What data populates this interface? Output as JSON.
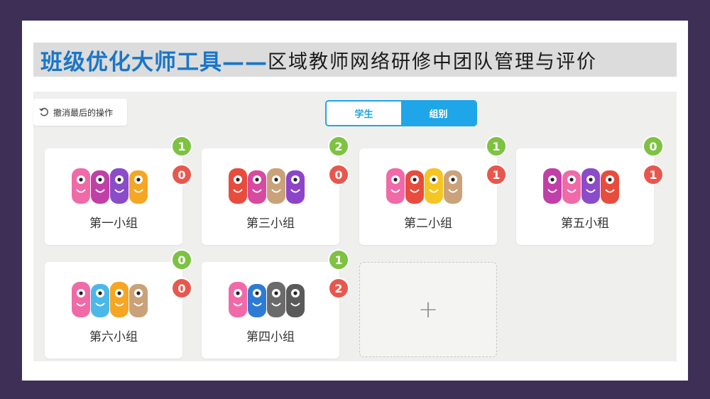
{
  "title": {
    "main": "班级优化大师工具——",
    "sub": "区域教师网络研修中团队管理与评价"
  },
  "toolbar": {
    "undo_label": "撤消最后的操作"
  },
  "view_toggle": {
    "students_label": "学生",
    "groups_label": "组别",
    "selected": "组别"
  },
  "groups": [
    {
      "name": "第一小组",
      "positive": "1",
      "negative": "0",
      "monsters": [
        "#f06aa8",
        "#c040a8",
        "#8a4cc8",
        "#f5a623"
      ]
    },
    {
      "name": "第三小组",
      "positive": "2",
      "negative": "0",
      "monsters": [
        "#e84c3d",
        "#d64aa0",
        "#c9a27a",
        "#8e44c8"
      ]
    },
    {
      "name": "第二小组",
      "positive": "1",
      "negative": "1",
      "monsters": [
        "#f06aa8",
        "#e84c3d",
        "#f5c623",
        "#caa37a"
      ]
    },
    {
      "name": "第五小租",
      "positive": "0",
      "negative": "1",
      "monsters": [
        "#c040a8",
        "#f06aa8",
        "#8a4cc8",
        "#e84c3d"
      ]
    },
    {
      "name": "第六小组",
      "positive": "0",
      "negative": "0",
      "monsters": [
        "#f06aa8",
        "#4ab8e8",
        "#f5a623",
        "#c9a27a"
      ]
    },
    {
      "name": "第四小组",
      "positive": "1",
      "negative": "2",
      "monsters": [
        "#f06aa8",
        "#2e7bd6",
        "#6b6b6b",
        "#5a5a5a"
      ]
    }
  ],
  "add_card": {
    "label": "+"
  },
  "colors": {
    "accent": "#1ea6e8",
    "positive": "#7dc242",
    "negative": "#e8574e",
    "title_blue": "#1976c8",
    "frame": "#3d2f56"
  }
}
